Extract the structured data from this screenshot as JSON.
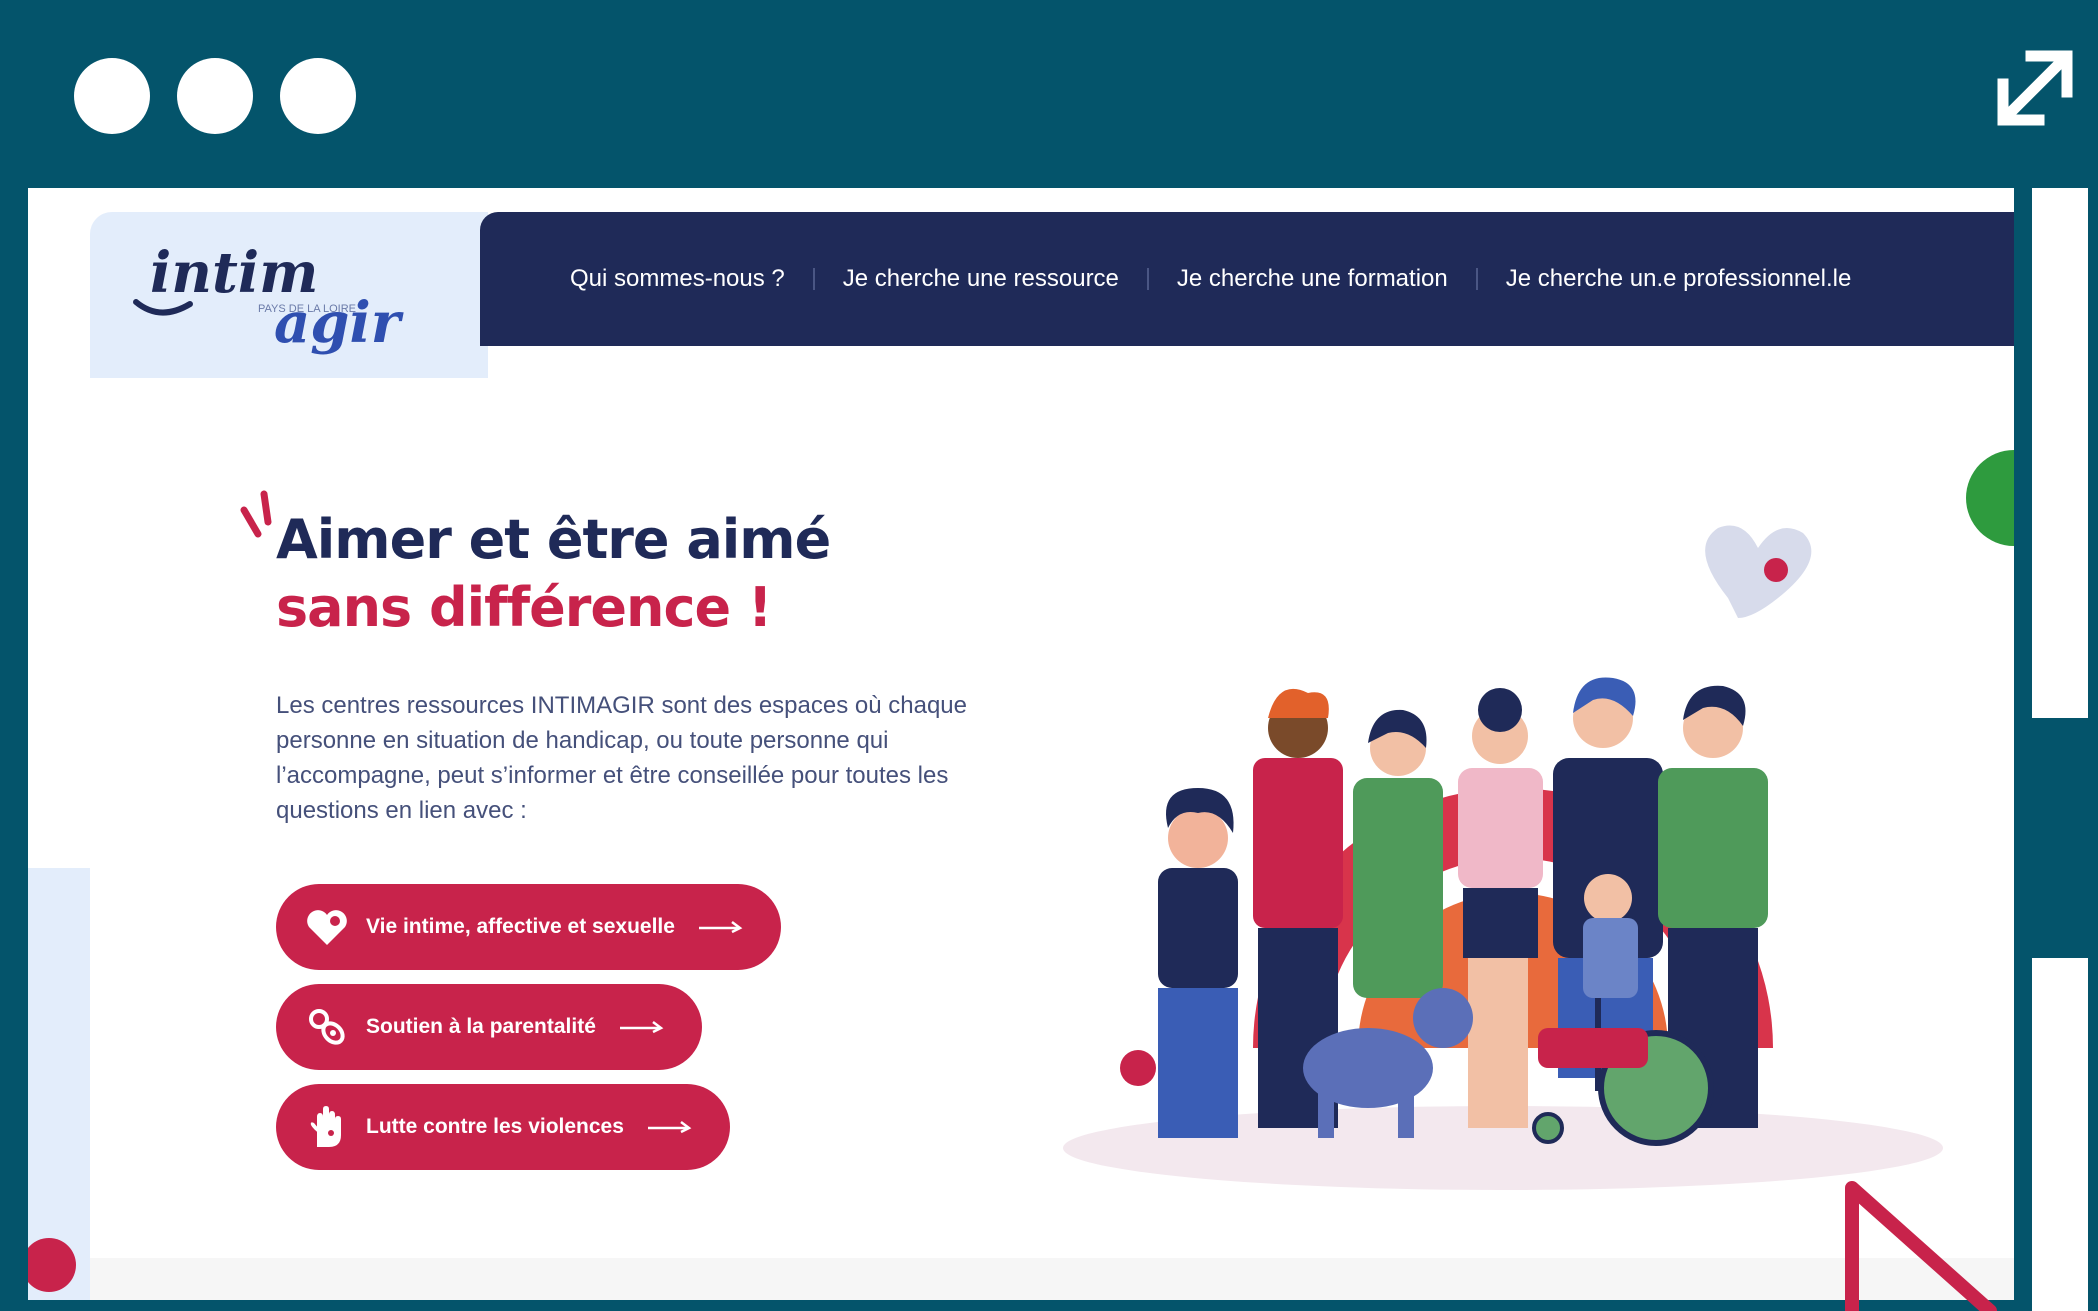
{
  "browser": {
    "window_dots": 3,
    "expand_icon": "expand-arrows-icon"
  },
  "site": {
    "logo": {
      "line1": "intim",
      "region": "PAYS DE LA LOIRE",
      "line2": "agir"
    },
    "nav": [
      {
        "label": "Qui sommes-nous ?"
      },
      {
        "label": "Je cherche une ressource"
      },
      {
        "label": "Je cherche une formation"
      },
      {
        "label": "Je cherche un.e professionnel.le"
      }
    ],
    "hero": {
      "title_line1": "Aimer et être aimé",
      "title_line2": "sans différence !",
      "intro": "Les centres ressources INTIMAGIR sont des espaces où chaque personne en situation de handicap, ou toute personne qui l’accompagne, peut s’informer et être conseillée pour toutes les questions en lien avec :"
    },
    "buttons": [
      {
        "label": "Vie intime, affective et sexuelle",
        "icon": "heart-icon"
      },
      {
        "label": "Soutien à la parentalité",
        "icon": "pacifier-icon"
      },
      {
        "label": "Lutte contre les violences",
        "icon": "hand-icon"
      }
    ],
    "colors": {
      "navy": "#1f2a58",
      "accent": "#c8234b",
      "frame": "#04546b",
      "logo_bg": "#e3edfb"
    }
  }
}
